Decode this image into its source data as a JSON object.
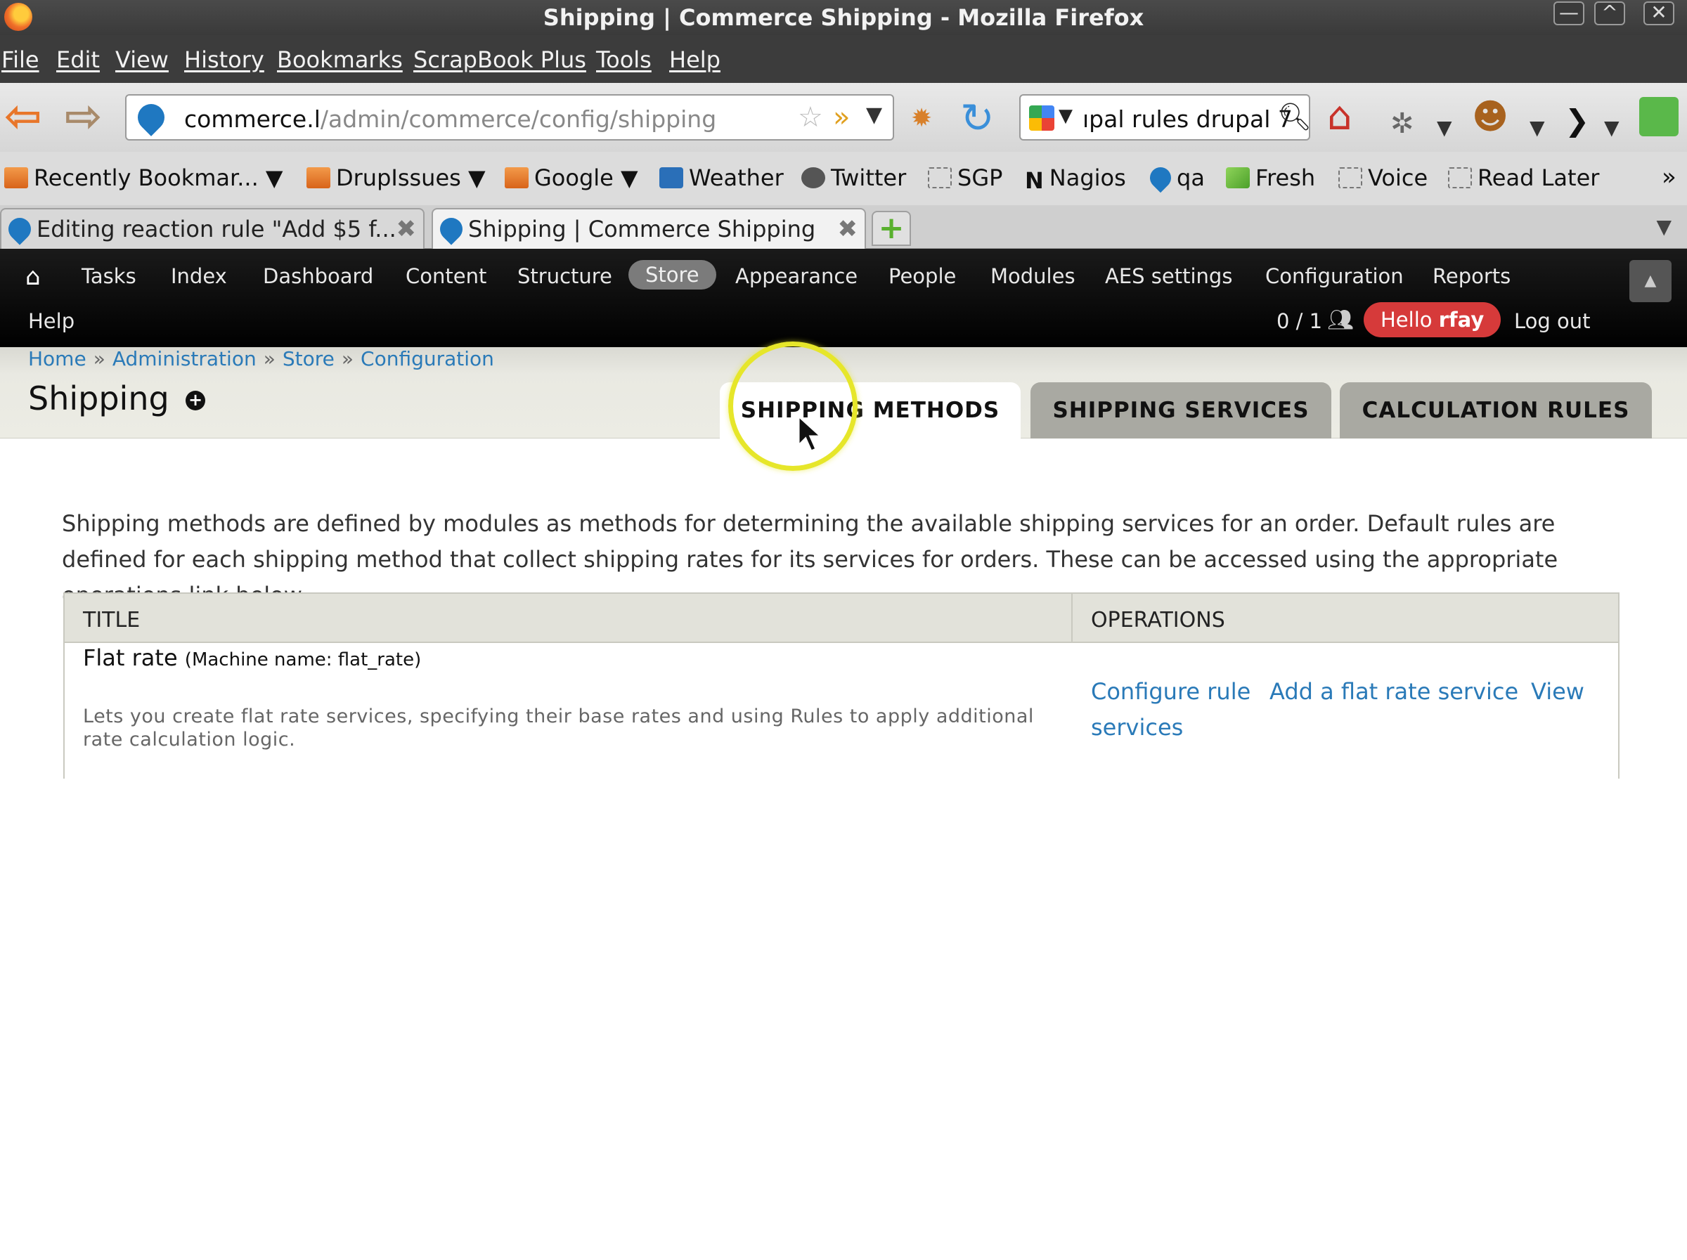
{
  "window": {
    "title": "Shipping | Commerce Shipping - Mozilla Firefox",
    "controls": [
      "—",
      "^",
      "✕"
    ]
  },
  "menubar": [
    "File",
    "Edit",
    "View",
    "History",
    "Bookmarks",
    "ScrapBook Plus",
    "Tools",
    "Help"
  ],
  "navbar": {
    "url_host": "commerce.l",
    "url_path": "/admin/commerce/config/shipping",
    "search_query": "ıpal rules drupal 7"
  },
  "bookmarks": [
    {
      "label": "Recently Bookmar... ▼",
      "icon": "recent-bookmarks-icon"
    },
    {
      "label": "DrupIssues ▼",
      "icon": "folder-icon"
    },
    {
      "label": "Google ▼",
      "icon": "folder-icon"
    },
    {
      "label": "Weather",
      "icon": "weather-icon"
    },
    {
      "label": "Twitter",
      "icon": "twitter-icon"
    },
    {
      "label": "SGP",
      "icon": "bookmark-page-icon"
    },
    {
      "label": "Nagios",
      "icon": "nagios-icon"
    },
    {
      "label": "qa",
      "icon": "drupal-icon"
    },
    {
      "label": "Fresh",
      "icon": "fresh-icon"
    },
    {
      "label": "Voice",
      "icon": "bookmark-page-icon"
    },
    {
      "label": "Read Later",
      "icon": "bookmark-page-icon"
    }
  ],
  "tabs": [
    {
      "label": "Editing reaction rule \"Add $5 f...",
      "active": false
    },
    {
      "label": "Shipping | Commerce Shipping",
      "active": true
    }
  ],
  "admin_menu": {
    "items": [
      "Tasks",
      "Index",
      "Dashboard",
      "Content",
      "Structure",
      "Store",
      "Appearance",
      "People",
      "Modules",
      "AES settings",
      "Configuration",
      "Reports"
    ],
    "help": "Help",
    "user_count": "0 / 1",
    "hello_prefix": "Hello",
    "username": "rfay",
    "logout": "Log out"
  },
  "breadcrumb": [
    "Home",
    "Administration",
    "Store",
    "Configuration"
  ],
  "page": {
    "title": "Shipping",
    "tabs": [
      "SHIPPING METHODS",
      "SHIPPING SERVICES",
      "CALCULATION RULES"
    ],
    "active_tab": "SHIPPING METHODS",
    "intro": "Shipping methods are defined by modules as methods for determining the available shipping services for an order. Default rules are defined for each shipping method that collect shipping rates for its services for orders. These can be accessed using the appropriate operations link below."
  },
  "table": {
    "headers": [
      "TITLE",
      "OPERATIONS"
    ],
    "rows": [
      {
        "title": "Flat rate",
        "machine_name": "(Machine name: flat_rate)",
        "description": "Lets you create flat rate services, specifying their base rates and using Rules to apply additional rate calculation logic.",
        "operations": [
          "Configure rule",
          "Add a flat rate service",
          "View",
          "services"
        ]
      }
    ]
  }
}
